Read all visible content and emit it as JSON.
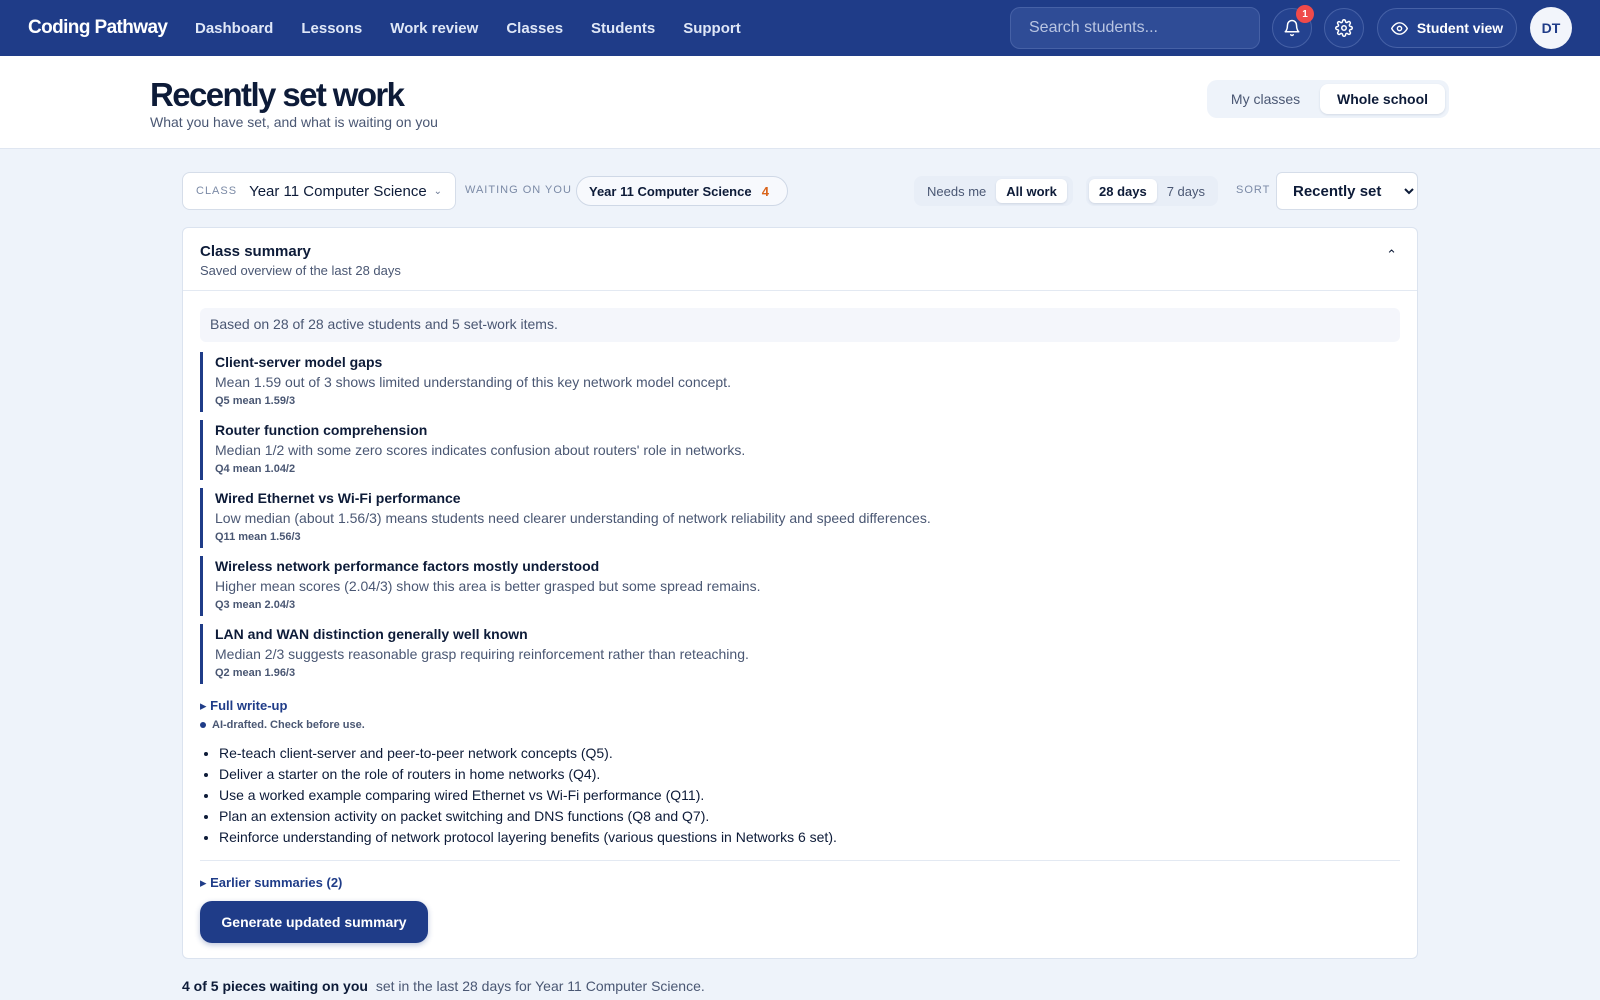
{
  "nav": {
    "logo": "Coding Pathway",
    "links": [
      "Dashboard",
      "Lessons",
      "Work review",
      "Classes",
      "Students",
      "Support"
    ],
    "search_placeholder": "Search students...",
    "notification_count": "1",
    "student_view_label": "Student view",
    "avatar_initials": "DT",
    "icons": [
      "bell-icon",
      "gear-icon",
      "eye-icon"
    ]
  },
  "header": {
    "title": "Recently set work",
    "subtitle": "What you have set, and what is waiting on you",
    "scope": {
      "my_classes": "My classes",
      "whole_school": "Whole school",
      "selected": "Whole school"
    }
  },
  "filters": {
    "class_label": "CLASS",
    "class_value": "Year 11 Computer Science",
    "waiting_label": "WAITING ON YOU",
    "waiting_chip_label": "Year 11 Computer Science",
    "waiting_chip_count": "4",
    "needs_me": "Needs me",
    "all_work": "All work",
    "days_28": "28 days",
    "days_7": "7 days",
    "sort_label": "SORT",
    "sort_value": "Recently set"
  },
  "summary": {
    "title": "Class summary",
    "subtitle": "Saved overview of the last 28 days",
    "basis": "Based on 28 of 28 active students and 5 set-work items.",
    "findings": [
      {
        "title": "Client-server model gaps",
        "desc": "Mean 1.59 out of 3 shows limited understanding of this key network model concept.",
        "stat": "Q5 mean 1.59/3"
      },
      {
        "title": "Router function comprehension",
        "desc": "Median 1/2 with some zero scores indicates confusion about routers' role in networks.",
        "stat": "Q4 mean 1.04/2"
      },
      {
        "title": "Wired Ethernet vs Wi-Fi performance",
        "desc": "Low median (about 1.56/3) means students need clearer understanding of network reliability and speed differences.",
        "stat": "Q11 mean 1.56/3"
      },
      {
        "title": "Wireless network performance factors mostly understood",
        "desc": "Higher mean scores (2.04/3) show this area is better grasped but some spread remains.",
        "stat": "Q3 mean 2.04/3"
      },
      {
        "title": "LAN and WAN distinction generally well known",
        "desc": "Median 2/3 suggests reasonable grasp requiring reinforcement rather than reteaching.",
        "stat": "Q2 mean 1.96/3"
      }
    ],
    "writeup_toggle": "▸ Full write-up",
    "ai_note": "AI-drafted. Check before use.",
    "actions": [
      "Re-teach client-server and peer-to-peer network concepts (Q5).",
      "Deliver a starter on the role of routers in home networks (Q4).",
      "Use a worked example comparing wired Ethernet vs Wi-Fi performance (Q11).",
      "Plan an extension activity on packet switching and DNS functions (Q8 and Q7).",
      "Reinforce understanding of network protocol layering benefits (various questions in Networks 6 set)."
    ],
    "earlier_toggle": "▸ Earlier summaries (2)",
    "generate_button": "Generate updated summary"
  },
  "footer": {
    "count_text": "4 of 5 pieces waiting on you",
    "detail": "set in the last 28 days for Year 11 Computer Science."
  },
  "colors": {
    "nav_bg": "#1f3c88",
    "accent": "#1f3c88",
    "badge": "#ef4a4a",
    "count_orange": "#d9641b",
    "page_bg": "#eef3fa"
  }
}
